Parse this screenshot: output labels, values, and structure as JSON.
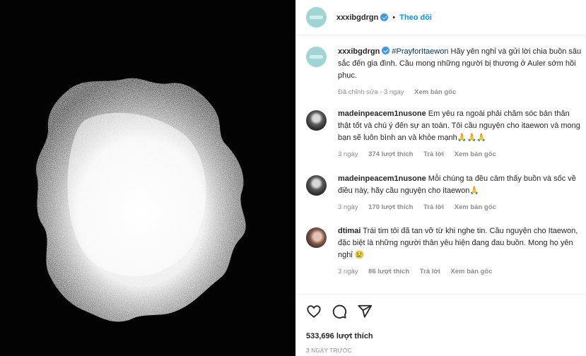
{
  "post": {
    "author": "xxxibgdrgn",
    "dot": "•",
    "follow_label": "Theo dõi",
    "likes": "533,696 lượt thích",
    "date": "3 NGÀY TRƯỚC"
  },
  "caption": {
    "username": "xxxibgdrgn",
    "hashtag": "#PrayforItaewon",
    "text": " Hãy yên nghỉ và gửi lời chia buồn sâu sắc đến gia đình. Cầu mong những người bị thương ở Auler sớm hồi phục.",
    "edited": "Đã chỉnh sửa · 3 ngày",
    "see_original": "Xem bản gốc"
  },
  "comments": [
    {
      "username": "madeinpeacem1nusone",
      "text": " Em yêu ra ngoài phải chăm sóc bản thân thật tốt và chú ý đến sự an toàn. Tôi cầu nguyện cho itaewon và mong bạn sẽ luôn bình an và khỏe mạnh🙏🙏🙏",
      "time": "3 ngày",
      "likes": "374 lượt thích",
      "reply": "Trả lời",
      "see_original": "Xem bản gốc"
    },
    {
      "username": "madeinpeacem1nusone",
      "text": " Mỗi chúng ta đều cảm thấy buồn và sốc về điều này, hãy cầu nguyện cho itaewon🙏",
      "time": "3 ngày",
      "likes": "170 lượt thích",
      "reply": "Trả lời",
      "see_original": "Xem bản gốc"
    },
    {
      "username": "dtimai",
      "text": " Trái tim tôi đã tan vỡ từ khi nghe tin. Cầu nguyện cho Itaewon, đặc biệt là những người thân yêu hiện đang đau buồn. Mong họ yên nghỉ 😢",
      "time": "3 ngày",
      "likes": "86 lượt thích",
      "reply": "Trả lời",
      "see_original": "Xem bản gốc"
    }
  ],
  "icons": {
    "like": "heart-icon",
    "comment": "comment-icon",
    "share": "share-icon"
  },
  "colors": {
    "link": "#0095f6",
    "verified": "#3897f0",
    "muted": "#8e8e8e",
    "avatar": "#9fd6d4"
  }
}
